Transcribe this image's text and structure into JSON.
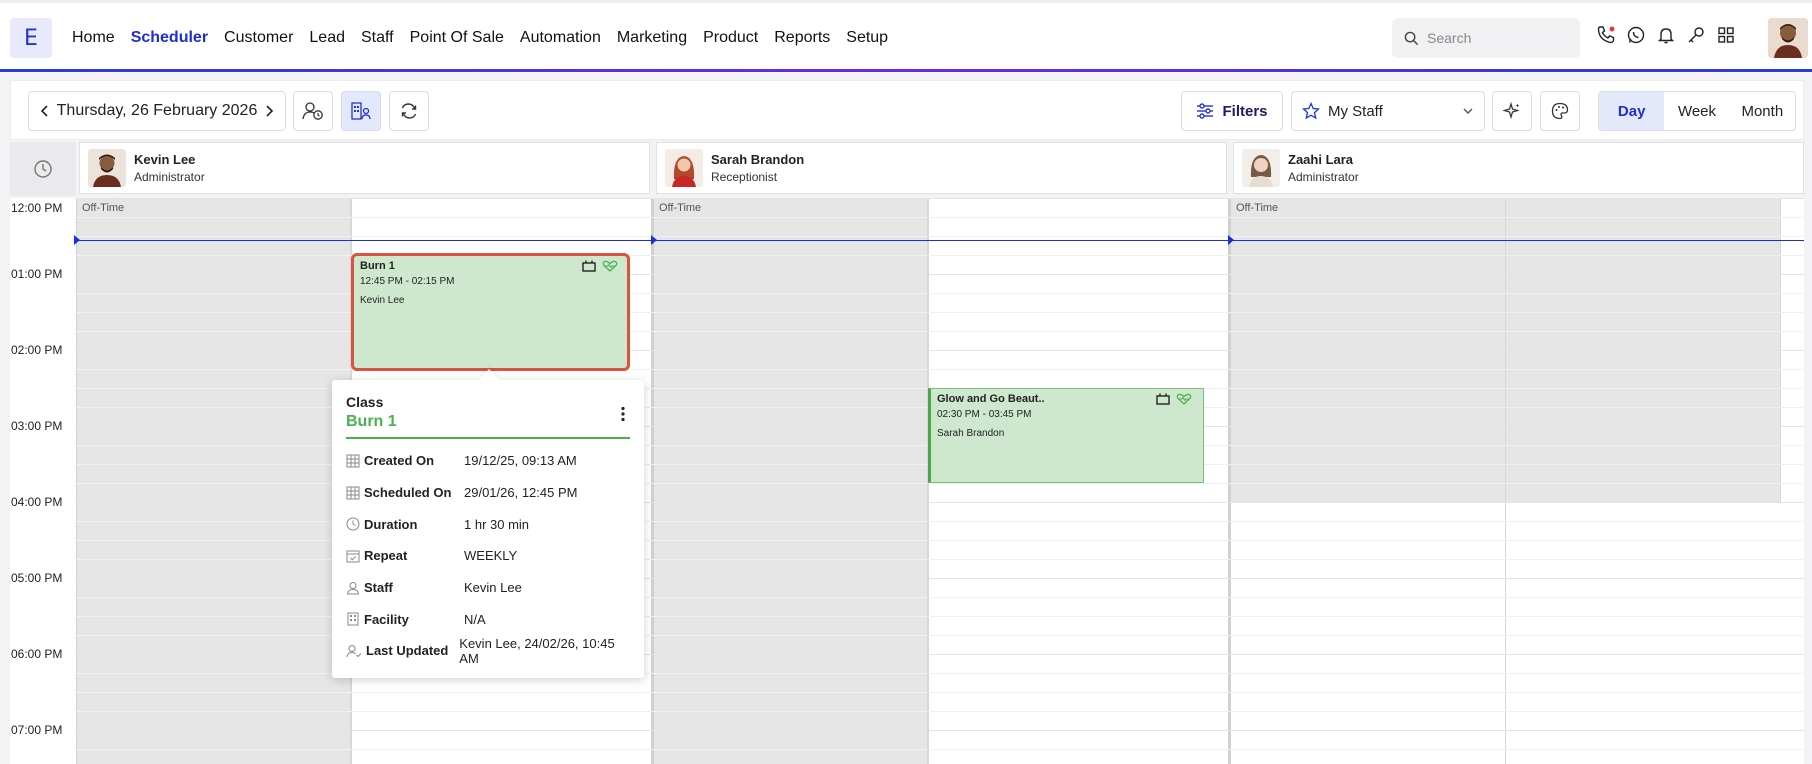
{
  "app": {
    "logo_letter": "E"
  },
  "nav": {
    "items": [
      "Home",
      "Scheduler",
      "Customer",
      "Lead",
      "Staff",
      "Point Of Sale",
      "Automation",
      "Marketing",
      "Product",
      "Reports",
      "Setup"
    ],
    "active": "Scheduler"
  },
  "search": {
    "placeholder": "Search"
  },
  "top_icons": [
    "phone-icon",
    "whatsapp-icon",
    "bell-icon",
    "key-icon",
    "apps-grid-icon"
  ],
  "toolbar": {
    "date_label": "Thursday, 26 February 2026",
    "filters_label": "Filters",
    "staff_select": "My Staff",
    "views": [
      "Day",
      "Week",
      "Month"
    ],
    "active_view": "Day"
  },
  "staff": [
    {
      "name": "Kevin Lee",
      "role": "Administrator"
    },
    {
      "name": "Sarah Brandon",
      "role": "Receptionist"
    },
    {
      "name": "Zaahi Lara",
      "role": "Administrator"
    }
  ],
  "time_labels": [
    "12:00 PM",
    "01:00 PM",
    "02:00 PM",
    "03:00 PM",
    "04:00 PM",
    "05:00 PM",
    "06:00 PM",
    "07:00 PM"
  ],
  "offtime_label": "Off-Time",
  "events": {
    "burn": {
      "title": "Burn 1",
      "time": "12:45 PM - 02:15 PM",
      "staff": "Kevin Lee"
    },
    "glow": {
      "title": "Glow and Go Beaut..",
      "time": "02:30 PM - 03:45 PM",
      "staff": "Sarah Brandon"
    }
  },
  "popover": {
    "type": "Class",
    "name": "Burn 1",
    "rows": [
      {
        "key": "Created On",
        "value": "19/12/25, 09:13 AM",
        "icon": "calendar-grid-icon"
      },
      {
        "key": "Scheduled On",
        "value": "29/01/26, 12:45 PM",
        "icon": "calendar-grid-icon"
      },
      {
        "key": "Duration",
        "value": "1 hr 30 min",
        "icon": "clock-icon"
      },
      {
        "key": "Repeat",
        "value": "WEEKLY",
        "icon": "calendar-check-icon"
      },
      {
        "key": "Staff",
        "value": "Kevin Lee",
        "icon": "user-icon"
      },
      {
        "key": "Facility",
        "value": "N/A",
        "icon": "building-icon"
      },
      {
        "key": "Last Updated",
        "value": "Kevin Lee, 24/02/26, 10:45 AM",
        "icon": "user-check-icon"
      }
    ]
  },
  "colors": {
    "accent": "#1f2dd6",
    "event_green": "#cde8cd",
    "event_border": "#4aa84a",
    "selected_border": "#d9533e",
    "now_line": "#1a2ee0"
  }
}
